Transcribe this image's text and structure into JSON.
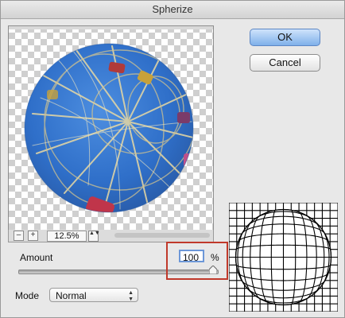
{
  "window": {
    "title": "Spherize"
  },
  "buttons": {
    "ok": "OK",
    "cancel": "Cancel"
  },
  "zoom": {
    "minus": "–",
    "plus": "+",
    "level": "12.5%",
    "stepper": "▲▼"
  },
  "amount": {
    "label": "Amount",
    "value": "100",
    "unit": "%",
    "level_percent": 100
  },
  "mode": {
    "label": "Mode",
    "selected": "Normal"
  },
  "colors": {
    "highlight": "#c0392b",
    "ok_button": "#7fb0ea",
    "sky": "#2f6fc9"
  }
}
